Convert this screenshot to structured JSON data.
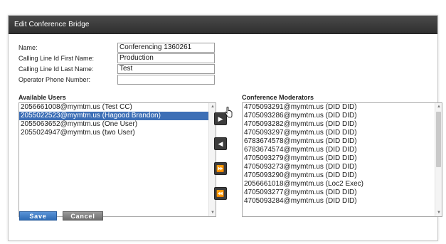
{
  "dialog": {
    "title": "Edit Conference Bridge"
  },
  "form": {
    "name_label": "Name:",
    "name_value": "Conferencing 1360261",
    "first_name_label": "Calling Line Id First Name:",
    "first_name_value": "Production",
    "last_name_label": "Calling Line Id Last Name:",
    "last_name_value": "Test",
    "operator_label": "Operator Phone Number:",
    "operator_value": ""
  },
  "available_users": {
    "label": "Available Users",
    "items": [
      "2056661008@mymtm.us (Test CC)",
      "2055022523@mymtm.us (Hagood Brandon)",
      "2055063652@mymtm.us (One User)",
      "2055024947@mymtm.us (two User)"
    ],
    "selected_index": 1
  },
  "moderators": {
    "label": "Conference Moderators",
    "items": [
      "4705093291@mymtm.us (DID DID)",
      "4705093286@mymtm.us (DID DID)",
      "4705093282@mymtm.us (DID DID)",
      "4705093297@mymtm.us (DID DID)",
      "6783674578@mymtm.us (DID DID)",
      "6783674574@mymtm.us (DID DID)",
      "4705093279@mymtm.us (DID DID)",
      "4705093273@mymtm.us (DID DID)",
      "4705093290@mymtm.us (DID DID)",
      "2056661018@mymtm.us (Loc2 Exec)",
      "4705093277@mymtm.us (DID DID)",
      "4705093284@mymtm.us (DID DID)"
    ]
  },
  "move_buttons": {
    "add_icon": "▶",
    "remove_icon": "◀",
    "add_all_icon": "⏩",
    "remove_all_icon": "⏪"
  },
  "actions": {
    "save_label": "Save",
    "cancel_label": "Cancel"
  },
  "colors": {
    "titlebar": "#3a3a3a",
    "selection": "#3d6fb6",
    "save_button": "#3f7cc4",
    "cancel_button": "#808080"
  }
}
